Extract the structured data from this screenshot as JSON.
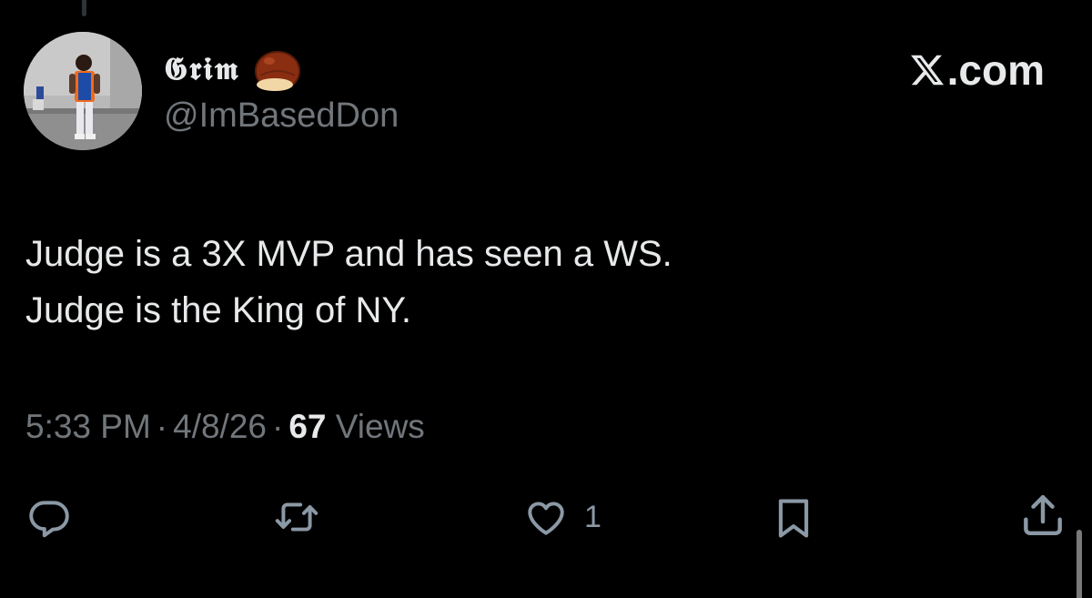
{
  "author": {
    "display_name": "𝕲𝖗𝖎𝖒",
    "handle": "@ImBasedDon",
    "name_emoji": "chestnut-emoji",
    "avatar": "profile-photo"
  },
  "brand": {
    "label": ".com",
    "icon": "x-logo-icon"
  },
  "tweet": {
    "lines": [
      "Judge is a 3X MVP and has seen a WS.",
      "Judge is the King of NY."
    ]
  },
  "meta": {
    "time": "5:33 PM",
    "separator": "·",
    "date": "4/8/26",
    "views_count": "67",
    "views_label": "Views"
  },
  "actions": {
    "reply_icon": "reply-icon",
    "repost_icon": "repost-icon",
    "like_icon": "heart-icon",
    "like_count": "1",
    "bookmark_icon": "bookmark-icon",
    "share_icon": "share-icon"
  },
  "colors": {
    "background": "#000000",
    "primary_text": "#e7e9ea",
    "secondary_text": "#71767b",
    "icon": "#8b98a5"
  }
}
